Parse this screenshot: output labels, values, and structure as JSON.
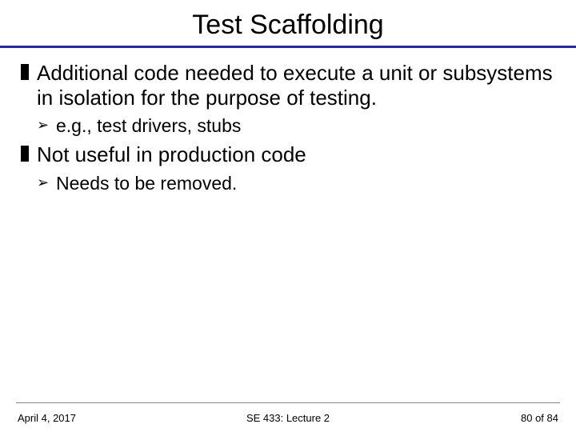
{
  "title": "Test Scaffolding",
  "bullets": [
    {
      "text": "Additional code needed to execute a unit or subsystems in isolation for the purpose of testing.",
      "sub": [
        "e.g., test drivers, stubs"
      ]
    },
    {
      "text": "Not useful in production code",
      "sub": [
        "Needs to be removed."
      ]
    }
  ],
  "footer": {
    "date": "April 4, 2017",
    "center": "SE 433: Lecture 2",
    "page": "80 of 84"
  }
}
